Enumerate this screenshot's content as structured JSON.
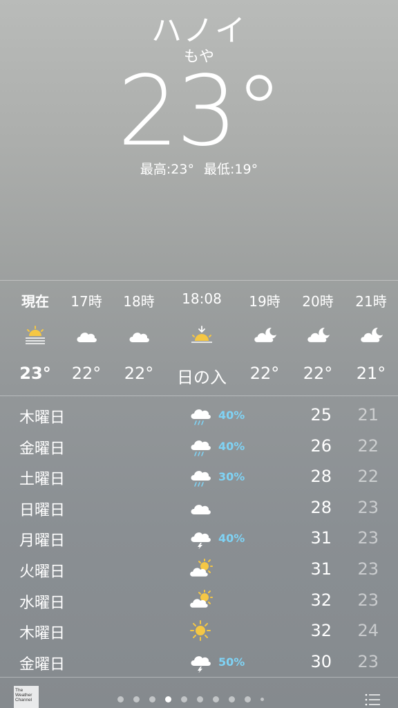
{
  "location": {
    "city": "ハノイ",
    "condition": "もや",
    "temperature": "23°",
    "high": "最高:23°",
    "low": "最低:19°"
  },
  "hourly": [
    {
      "time": "現在",
      "icon": "sun-haze-icon",
      "temp": "23°"
    },
    {
      "time": "17時",
      "icon": "cloud-icon",
      "temp": "22°"
    },
    {
      "time": "18時",
      "icon": "cloud-icon",
      "temp": "22°"
    },
    {
      "time": "18:08",
      "icon": "sunset-icon",
      "temp": "日の入"
    },
    {
      "time": "19時",
      "icon": "cloud-moon-icon",
      "temp": "22°"
    },
    {
      "time": "20時",
      "icon": "cloud-moon-icon",
      "temp": "22°"
    },
    {
      "time": "21時",
      "icon": "cloud-moon-icon",
      "temp": "21°"
    }
  ],
  "daily": [
    {
      "day": "木曜日",
      "icon": "cloud-rain-icon",
      "pop": "40%",
      "high": "25",
      "low": "21"
    },
    {
      "day": "金曜日",
      "icon": "cloud-rain-icon",
      "pop": "40%",
      "high": "26",
      "low": "22"
    },
    {
      "day": "土曜日",
      "icon": "cloud-rain-icon",
      "pop": "30%",
      "high": "28",
      "low": "22"
    },
    {
      "day": "日曜日",
      "icon": "cloud-icon",
      "pop": "",
      "high": "28",
      "low": "23"
    },
    {
      "day": "月曜日",
      "icon": "cloud-thunder-icon",
      "pop": "40%",
      "high": "31",
      "low": "23"
    },
    {
      "day": "火曜日",
      "icon": "partly-cloudy-icon",
      "pop": "",
      "high": "31",
      "low": "23"
    },
    {
      "day": "水曜日",
      "icon": "partly-cloudy-icon",
      "pop": "",
      "high": "32",
      "low": "23"
    },
    {
      "day": "木曜日",
      "icon": "sun-icon",
      "pop": "",
      "high": "32",
      "low": "24"
    },
    {
      "day": "金曜日",
      "icon": "cloud-thunder-icon",
      "pop": "50%",
      "high": "30",
      "low": "23"
    }
  ],
  "footer": {
    "logo_text": "The Weather Channel",
    "page_count": 10,
    "active_page": 3
  },
  "colors": {
    "precip": "#7fd3f5",
    "sun": "#f5c744"
  }
}
